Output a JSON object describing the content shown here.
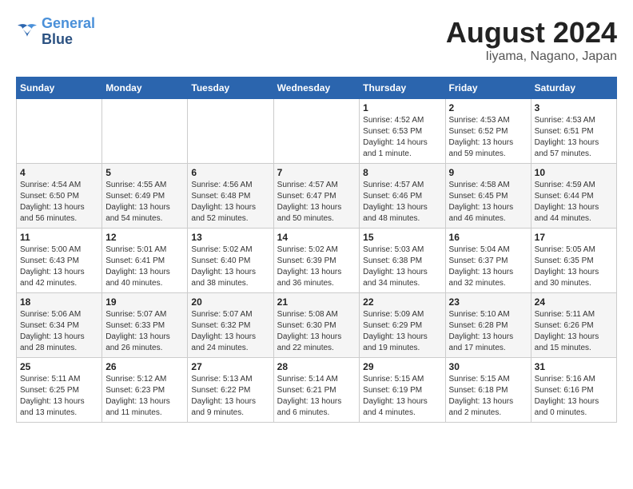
{
  "header": {
    "logo_line1": "General",
    "logo_line2": "Blue",
    "title": "August 2024",
    "subtitle": "Iiyama, Nagano, Japan"
  },
  "weekdays": [
    "Sunday",
    "Monday",
    "Tuesday",
    "Wednesday",
    "Thursday",
    "Friday",
    "Saturday"
  ],
  "weeks": [
    [
      {
        "day": "",
        "info": ""
      },
      {
        "day": "",
        "info": ""
      },
      {
        "day": "",
        "info": ""
      },
      {
        "day": "",
        "info": ""
      },
      {
        "day": "1",
        "info": "Sunrise: 4:52 AM\nSunset: 6:53 PM\nDaylight: 14 hours\nand 1 minute."
      },
      {
        "day": "2",
        "info": "Sunrise: 4:53 AM\nSunset: 6:52 PM\nDaylight: 13 hours\nand 59 minutes."
      },
      {
        "day": "3",
        "info": "Sunrise: 4:53 AM\nSunset: 6:51 PM\nDaylight: 13 hours\nand 57 minutes."
      }
    ],
    [
      {
        "day": "4",
        "info": "Sunrise: 4:54 AM\nSunset: 6:50 PM\nDaylight: 13 hours\nand 56 minutes."
      },
      {
        "day": "5",
        "info": "Sunrise: 4:55 AM\nSunset: 6:49 PM\nDaylight: 13 hours\nand 54 minutes."
      },
      {
        "day": "6",
        "info": "Sunrise: 4:56 AM\nSunset: 6:48 PM\nDaylight: 13 hours\nand 52 minutes."
      },
      {
        "day": "7",
        "info": "Sunrise: 4:57 AM\nSunset: 6:47 PM\nDaylight: 13 hours\nand 50 minutes."
      },
      {
        "day": "8",
        "info": "Sunrise: 4:57 AM\nSunset: 6:46 PM\nDaylight: 13 hours\nand 48 minutes."
      },
      {
        "day": "9",
        "info": "Sunrise: 4:58 AM\nSunset: 6:45 PM\nDaylight: 13 hours\nand 46 minutes."
      },
      {
        "day": "10",
        "info": "Sunrise: 4:59 AM\nSunset: 6:44 PM\nDaylight: 13 hours\nand 44 minutes."
      }
    ],
    [
      {
        "day": "11",
        "info": "Sunrise: 5:00 AM\nSunset: 6:43 PM\nDaylight: 13 hours\nand 42 minutes."
      },
      {
        "day": "12",
        "info": "Sunrise: 5:01 AM\nSunset: 6:41 PM\nDaylight: 13 hours\nand 40 minutes."
      },
      {
        "day": "13",
        "info": "Sunrise: 5:02 AM\nSunset: 6:40 PM\nDaylight: 13 hours\nand 38 minutes."
      },
      {
        "day": "14",
        "info": "Sunrise: 5:02 AM\nSunset: 6:39 PM\nDaylight: 13 hours\nand 36 minutes."
      },
      {
        "day": "15",
        "info": "Sunrise: 5:03 AM\nSunset: 6:38 PM\nDaylight: 13 hours\nand 34 minutes."
      },
      {
        "day": "16",
        "info": "Sunrise: 5:04 AM\nSunset: 6:37 PM\nDaylight: 13 hours\nand 32 minutes."
      },
      {
        "day": "17",
        "info": "Sunrise: 5:05 AM\nSunset: 6:35 PM\nDaylight: 13 hours\nand 30 minutes."
      }
    ],
    [
      {
        "day": "18",
        "info": "Sunrise: 5:06 AM\nSunset: 6:34 PM\nDaylight: 13 hours\nand 28 minutes."
      },
      {
        "day": "19",
        "info": "Sunrise: 5:07 AM\nSunset: 6:33 PM\nDaylight: 13 hours\nand 26 minutes."
      },
      {
        "day": "20",
        "info": "Sunrise: 5:07 AM\nSunset: 6:32 PM\nDaylight: 13 hours\nand 24 minutes."
      },
      {
        "day": "21",
        "info": "Sunrise: 5:08 AM\nSunset: 6:30 PM\nDaylight: 13 hours\nand 22 minutes."
      },
      {
        "day": "22",
        "info": "Sunrise: 5:09 AM\nSunset: 6:29 PM\nDaylight: 13 hours\nand 19 minutes."
      },
      {
        "day": "23",
        "info": "Sunrise: 5:10 AM\nSunset: 6:28 PM\nDaylight: 13 hours\nand 17 minutes."
      },
      {
        "day": "24",
        "info": "Sunrise: 5:11 AM\nSunset: 6:26 PM\nDaylight: 13 hours\nand 15 minutes."
      }
    ],
    [
      {
        "day": "25",
        "info": "Sunrise: 5:11 AM\nSunset: 6:25 PM\nDaylight: 13 hours\nand 13 minutes."
      },
      {
        "day": "26",
        "info": "Sunrise: 5:12 AM\nSunset: 6:23 PM\nDaylight: 13 hours\nand 11 minutes."
      },
      {
        "day": "27",
        "info": "Sunrise: 5:13 AM\nSunset: 6:22 PM\nDaylight: 13 hours\nand 9 minutes."
      },
      {
        "day": "28",
        "info": "Sunrise: 5:14 AM\nSunset: 6:21 PM\nDaylight: 13 hours\nand 6 minutes."
      },
      {
        "day": "29",
        "info": "Sunrise: 5:15 AM\nSunset: 6:19 PM\nDaylight: 13 hours\nand 4 minutes."
      },
      {
        "day": "30",
        "info": "Sunrise: 5:15 AM\nSunset: 6:18 PM\nDaylight: 13 hours\nand 2 minutes."
      },
      {
        "day": "31",
        "info": "Sunrise: 5:16 AM\nSunset: 6:16 PM\nDaylight: 13 hours\nand 0 minutes."
      }
    ]
  ]
}
